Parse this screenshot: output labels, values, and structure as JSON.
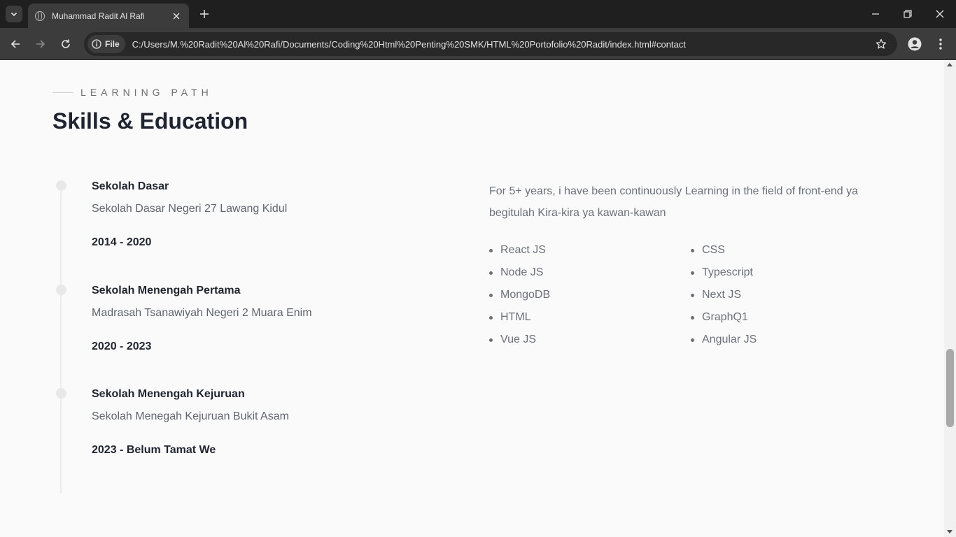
{
  "browser": {
    "tab_title": "Muhammad Radit Al Rafi",
    "chip_label": "File",
    "url": "C:/Users/M.%20Radit%20Al%20Rafi/Documents/Coding%20Html%20Penting%20SMK/HTML%20Portofolio%20Radit/index.html#contact"
  },
  "section": {
    "eyebrow": "LEARNING PATH",
    "title": "Skills & Education"
  },
  "education": [
    {
      "school": "Sekolah Dasar",
      "name": "Sekolah Dasar Negeri 27 Lawang Kidul",
      "years": "2014 - 2020"
    },
    {
      "school": "Sekolah Menengah Pertama",
      "name": "Madrasah Tsanawiyah Negeri 2 Muara Enim",
      "years": "2020 - 2023"
    },
    {
      "school": "Sekolah Menengah Kejuruan",
      "name": "Sekolah Menegah Kejuruan Bukit Asam",
      "years": "2023 - Belum Tamat We"
    }
  ],
  "about": "For 5+ years, i have been continuously Learning in the field of front-end ya begitulah Kira-kira ya kawan-kawan",
  "skills_left": [
    "React JS",
    "Node JS",
    "MongoDB",
    "HTML",
    "Vue JS"
  ],
  "skills_right": [
    "CSS",
    "Typescript",
    "Next JS",
    "GraphQ1",
    "Angular JS"
  ]
}
